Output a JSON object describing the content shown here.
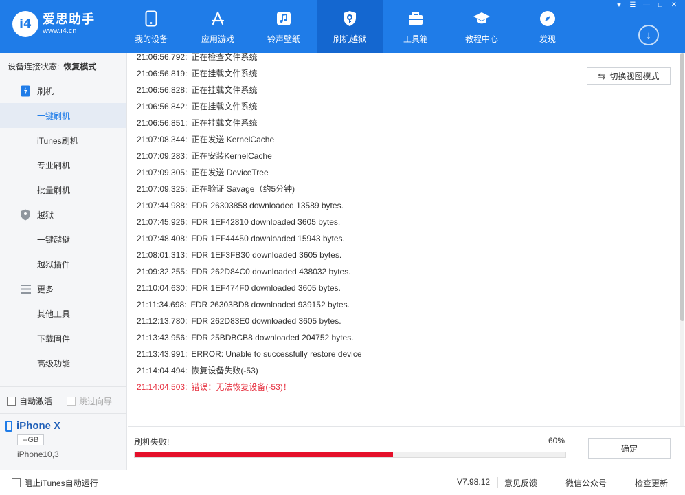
{
  "window": {
    "controls": [
      "shirt-icon",
      "menu-icon",
      "minimize-icon",
      "maximize-icon",
      "close-icon"
    ]
  },
  "brand": {
    "badge": "i4",
    "name": "爱思助手",
    "url": "www.i4.cn"
  },
  "colors": {
    "topbar": "#1f7ce8",
    "topbar_active": "#1467d0",
    "error": "#e6303f",
    "progress": "#e5102a",
    "sidebar_active_bg": "#e5ebf4"
  },
  "nav": [
    {
      "label": "我的设备",
      "icon": "device-icon"
    },
    {
      "label": "应用游戏",
      "icon": "app-store-icon"
    },
    {
      "label": "铃声壁纸",
      "icon": "music-icon"
    },
    {
      "label": "刷机越狱",
      "icon": "shield-key-icon",
      "active": true
    },
    {
      "label": "工具箱",
      "icon": "toolbox-icon"
    },
    {
      "label": "教程中心",
      "icon": "graduation-cap-icon"
    },
    {
      "label": "发现",
      "icon": "compass-icon"
    }
  ],
  "sidebar": {
    "connection_label": "设备连接状态:",
    "connection_value": "恢复模式",
    "items": [
      {
        "label": "刷机",
        "type": "group",
        "icon": "flash-phone-icon"
      },
      {
        "label": "一键刷机",
        "type": "sub",
        "active": true
      },
      {
        "label": "iTunes刷机",
        "type": "sub"
      },
      {
        "label": "专业刷机",
        "type": "sub"
      },
      {
        "label": "批量刷机",
        "type": "sub"
      },
      {
        "label": "越狱",
        "type": "group",
        "icon": "shield-icon"
      },
      {
        "label": "一键越狱",
        "type": "sub"
      },
      {
        "label": "越狱插件",
        "type": "sub"
      },
      {
        "label": "更多",
        "type": "group",
        "icon": "list-icon"
      },
      {
        "label": "其他工具",
        "type": "sub"
      },
      {
        "label": "下载固件",
        "type": "sub"
      },
      {
        "label": "高级功能",
        "type": "sub"
      }
    ],
    "auto_activate": "自动激活",
    "skip_guide": "跳过向导"
  },
  "device": {
    "name": "iPhone X",
    "capacity": "--GB",
    "model": "iPhone10,3"
  },
  "log": {
    "switch_view": "切换视图模式",
    "lines": [
      {
        "ts": "21:06:56.792:",
        "msg": "正在检查文件系统"
      },
      {
        "ts": "21:06:56.819:",
        "msg": "正在挂载文件系统"
      },
      {
        "ts": "21:06:56.828:",
        "msg": "正在挂载文件系统"
      },
      {
        "ts": "21:06:56.842:",
        "msg": "正在挂载文件系统"
      },
      {
        "ts": "21:06:56.851:",
        "msg": "正在挂载文件系统"
      },
      {
        "ts": "21:07:08.344:",
        "msg": "正在发送 KernelCache"
      },
      {
        "ts": "21:07:09.283:",
        "msg": "正在安装KernelCache"
      },
      {
        "ts": "21:07:09.305:",
        "msg": "正在发送 DeviceTree"
      },
      {
        "ts": "21:07:09.325:",
        "msg": "正在验证 Savage（约5分钟)"
      },
      {
        "ts": "21:07:44.988:",
        "msg": "FDR 26303858 downloaded 13589 bytes."
      },
      {
        "ts": "21:07:45.926:",
        "msg": "FDR 1EF42810 downloaded 3605 bytes."
      },
      {
        "ts": "21:07:48.408:",
        "msg": "FDR 1EF44450 downloaded 15943 bytes."
      },
      {
        "ts": "21:08:01.313:",
        "msg": "FDR 1EF3FB30 downloaded 3605 bytes."
      },
      {
        "ts": "21:09:32.255:",
        "msg": "FDR 262D84C0 downloaded 438032 bytes."
      },
      {
        "ts": "21:10:04.630:",
        "msg": "FDR 1EF474F0 downloaded 3605 bytes."
      },
      {
        "ts": "21:11:34.698:",
        "msg": "FDR 26303BD8 downloaded 939152 bytes."
      },
      {
        "ts": "21:12:13.780:",
        "msg": "FDR 262D83E0 downloaded 3605 bytes."
      },
      {
        "ts": "21:13:43.956:",
        "msg": "FDR 25BDBCB8 downloaded 204752 bytes."
      },
      {
        "ts": "21:13:43.991:",
        "msg": "ERROR: Unable to successfully restore device"
      },
      {
        "ts": "21:14:04.494:",
        "msg": "恢复设备失败(-53)"
      },
      {
        "ts": "21:14:04.503:",
        "msg": "错误：无法恢复设备(-53)！",
        "error": true
      }
    ]
  },
  "status": {
    "text": "刷机失败!",
    "percent_label": "60%",
    "progress": 0.6,
    "ok_button": "确定"
  },
  "footer": {
    "itunes_block": "阻止iTunes自动运行",
    "version": "V7.98.12",
    "feedback": "意见反馈",
    "wechat": "微信公众号",
    "update": "检查更新"
  }
}
